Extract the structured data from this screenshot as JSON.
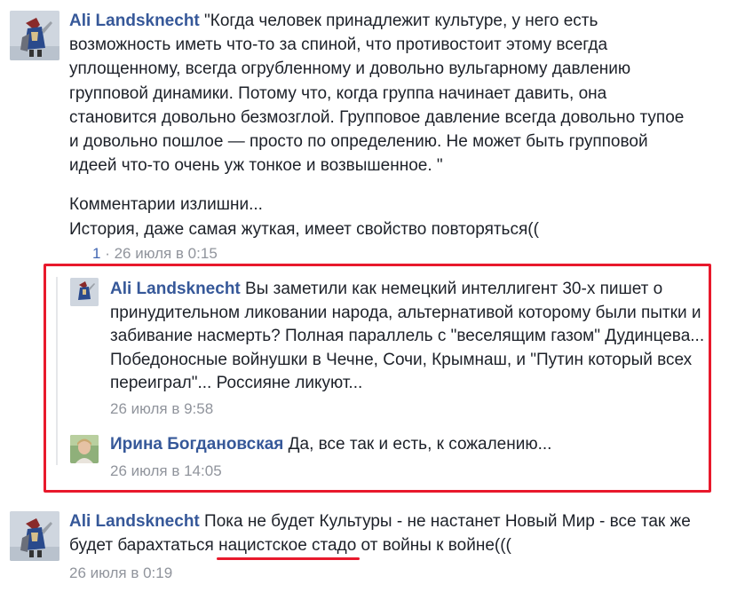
{
  "comments": [
    {
      "author": "Ali Landsknecht",
      "text": "\"Когда человек принадлежит культуре, у него есть возможность иметь что-то за спиной, что противостоит этому всегда уплощенному, всегда огрубленному и довольно вульгарному давлению групповой динамики. Потому что, когда группа начинает давить, она становится довольно безмозглой. Групповое давление всегда довольно тупое и довольно пошлое — просто по определению. Не может быть групповой идеей что-то очень уж тонкое и возвышенное. \"",
      "extra_line1": "Комментарии излишни...",
      "extra_line2": "История, даже самая жуткая, имеет свойство повторяться((",
      "like_count": "1",
      "separator": " · ",
      "timestamp": "26 июля в 0:15"
    }
  ],
  "replies": [
    {
      "author": "Ali Landsknecht",
      "text": "Вы заметили как немецкий интеллигент 30-х пишет о принудительном ликовании народа, альтернативой которому были пытки и забивание насмерть? Полная параллель с \"веселящим газом\" Дудинцева... Победоносные войнушки в Чечне, Сочи, Крымнаш, и \"Путин который всех переиграл\"... Россияне ликуют...",
      "timestamp": "26 июля в 9:58"
    },
    {
      "author": "Ирина Богдановская",
      "text": "Да, все так и есть, к сожалению...",
      "timestamp": "26 июля в 14:05"
    }
  ],
  "last_comment": {
    "author": "Ali Landsknecht",
    "text_before": "Пока не будет Культуры - не настанет Новый Мир - все так же будет барахтаться ",
    "text_underlined": "нацистское стадо",
    "text_after": " от войны к войне(((",
    "timestamp": "26 июля в 0:19"
  },
  "colors": {
    "author_link": "#365899",
    "meta_gray": "#90949c",
    "highlight_red": "#e8192c"
  }
}
